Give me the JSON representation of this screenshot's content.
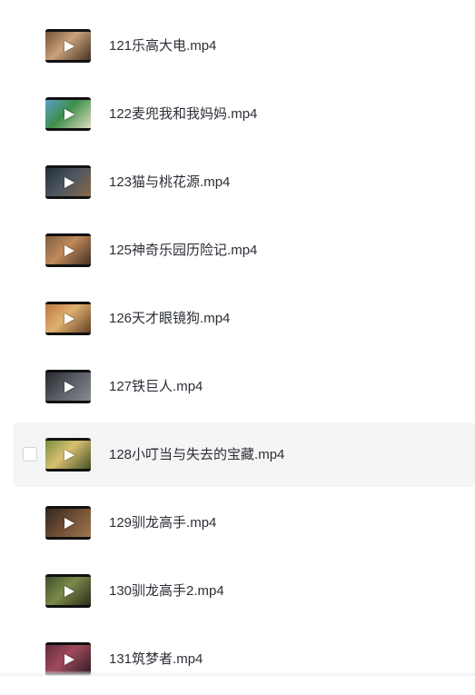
{
  "files": [
    {
      "name": "121乐高大电.mp4",
      "thumb_colors": [
        "#6b4a2f",
        "#c9a27a",
        "#3b2a1e"
      ],
      "hovered": false
    },
    {
      "name": "122麦兜我和我妈妈.mp4",
      "thumb_colors": [
        "#5aa0d6",
        "#3f8f4a",
        "#e8e2c8"
      ],
      "hovered": false
    },
    {
      "name": "123猫与桃花源.mp4",
      "thumb_colors": [
        "#1f2a33",
        "#4b5560",
        "#8a6a4a"
      ],
      "hovered": false
    },
    {
      "name": "125神奇乐园历险记.mp4",
      "thumb_colors": [
        "#7a5a3e",
        "#c08a5a",
        "#3a2a20"
      ],
      "hovered": false
    },
    {
      "name": "126天才眼镜狗.mp4",
      "thumb_colors": [
        "#b8743a",
        "#e0b070",
        "#5a3a22"
      ],
      "hovered": false
    },
    {
      "name": "127铁巨人.mp4",
      "thumb_colors": [
        "#222428",
        "#555a60",
        "#8b8f95"
      ],
      "hovered": false
    },
    {
      "name": "128小叮当与失去的宝藏.mp4",
      "thumb_colors": [
        "#6e8a3a",
        "#d8c070",
        "#3c4a22"
      ],
      "hovered": true
    },
    {
      "name": "129驯龙高手.mp4",
      "thumb_colors": [
        "#2a2420",
        "#6a4a32",
        "#a07a50"
      ],
      "hovered": false
    },
    {
      "name": "130驯龙高手2.mp4",
      "thumb_colors": [
        "#3a4a2a",
        "#7a8a4a",
        "#2a2418"
      ],
      "hovered": false
    },
    {
      "name": "131筑梦者.mp4",
      "thumb_colors": [
        "#5a2a3a",
        "#a04a5a",
        "#2a1a22"
      ],
      "hovered": false
    }
  ],
  "icons": {
    "play": "play-icon",
    "checkbox": "checkbox-icon"
  }
}
